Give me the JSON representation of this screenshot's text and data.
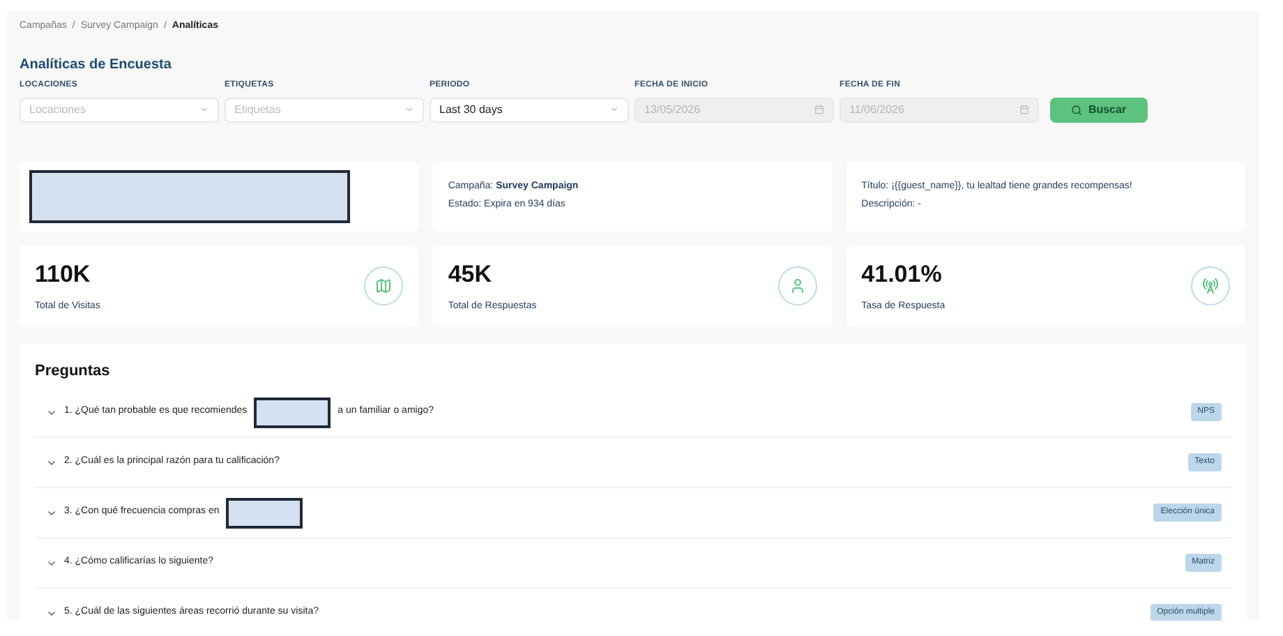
{
  "breadcrumb": [
    {
      "label": "Campañas",
      "current": false
    },
    {
      "separator": "/",
      "label": "Survey Campaign",
      "current": false
    },
    {
      "separator": "/",
      "label": "Analíticas",
      "current": true
    }
  ],
  "title": "Analíticas de Encuesta",
  "filters": [
    {
      "kind": "select",
      "label": "LOCACIONES",
      "placeholder": "Locaciones"
    },
    {
      "kind": "select",
      "label": "ETIQUETAS",
      "placeholder": "Etiquetas"
    },
    {
      "kind": "select",
      "label": "PERIODO",
      "value": "Last 30 days"
    },
    {
      "kind": "date",
      "label": "FECHA DE INICIO",
      "value": "13/05/2026",
      "disabled": true
    },
    {
      "kind": "date",
      "label": "FECHA DE FIN",
      "value": "11/06/2026",
      "disabled": true
    }
  ],
  "search_button": "Buscar",
  "logo_card": {
    "redacted": true
  },
  "campaign_card": [
    {
      "label": "Campaña:",
      "value": "Survey Campaign",
      "bold": true
    },
    {
      "label": "Estado:",
      "value": "Expira en 934 días",
      "bold": false
    }
  ],
  "message_card": [
    {
      "label": "Título:",
      "value": "¡{{guest_name}}, tu lealtad tiene grandes recompensas!",
      "bold": false
    },
    {
      "label": "Descripción:",
      "value": "-",
      "bold": false
    }
  ],
  "stats": [
    {
      "value": "110K",
      "label": "Total de Visitas",
      "kind": "visits"
    },
    {
      "value": "45K",
      "label": "Total de Respuestas",
      "kind": "responses"
    },
    {
      "value": "41.01%",
      "label": "Tasa de Respuesta",
      "kind": "rate"
    }
  ],
  "questions_title": "Preguntas",
  "questions": [
    {
      "text": "1. ¿Qué tan probable es que recomiendes",
      "redacted": true,
      "text_after": "a un familiar o amigo?",
      "tag": "NPS",
      "expanded": false
    },
    {
      "text": "2. ¿Cuál es la principal razón para tu calificación?",
      "redacted": false,
      "tag": "Texto",
      "expanded": false
    },
    {
      "text": "3. ¿Con qué frecuencia compras en",
      "redacted": true,
      "tag": "Elección única",
      "expanded": false
    },
    {
      "text": "4. ¿Cómo calificarías lo siguiente?",
      "redacted": false,
      "tag": "Matriz",
      "expanded": false
    },
    {
      "text": "5. ¿Cuál de las siguientes áreas recorrió durante su visita?",
      "redacted": false,
      "tag": "Opción multiple",
      "expanded": false
    }
  ]
}
